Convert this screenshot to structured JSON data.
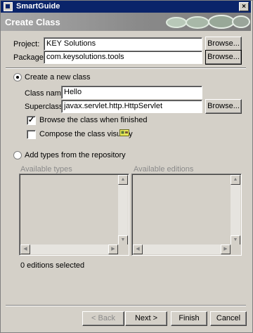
{
  "window": {
    "title": "SmartGuide"
  },
  "header": {
    "title": "Create Class"
  },
  "project": {
    "label": "Project:",
    "value": "KEY Solutions",
    "browse": "Browse..."
  },
  "package": {
    "label": "Package:",
    "value": "com.keysolutions.tools",
    "browse": "Browse..."
  },
  "create_new": {
    "label": "Create a new class",
    "selected": true
  },
  "class_name": {
    "label": "Class name:",
    "value": "Hello"
  },
  "superclass": {
    "label": "Superclass:",
    "value": "javax.servlet.http.HttpServlet",
    "browse": "Browse..."
  },
  "browse_when_finished": {
    "label": "Browse the class when finished",
    "checked": true,
    "mark": "✓"
  },
  "compose_visually": {
    "label": "Compose the class visually",
    "checked": false
  },
  "add_types": {
    "label": "Add types from the repository",
    "selected": false
  },
  "available_types": {
    "label": "Available types"
  },
  "available_editions": {
    "label": "Available editions"
  },
  "status": {
    "text": "0 editions selected"
  },
  "footer": {
    "back": "< Back",
    "next": "Next >",
    "finish": "Finish",
    "cancel": "Cancel"
  },
  "icons": {
    "close": "×",
    "up": "▲",
    "down": "▼",
    "left": "◀",
    "right": "▶"
  }
}
